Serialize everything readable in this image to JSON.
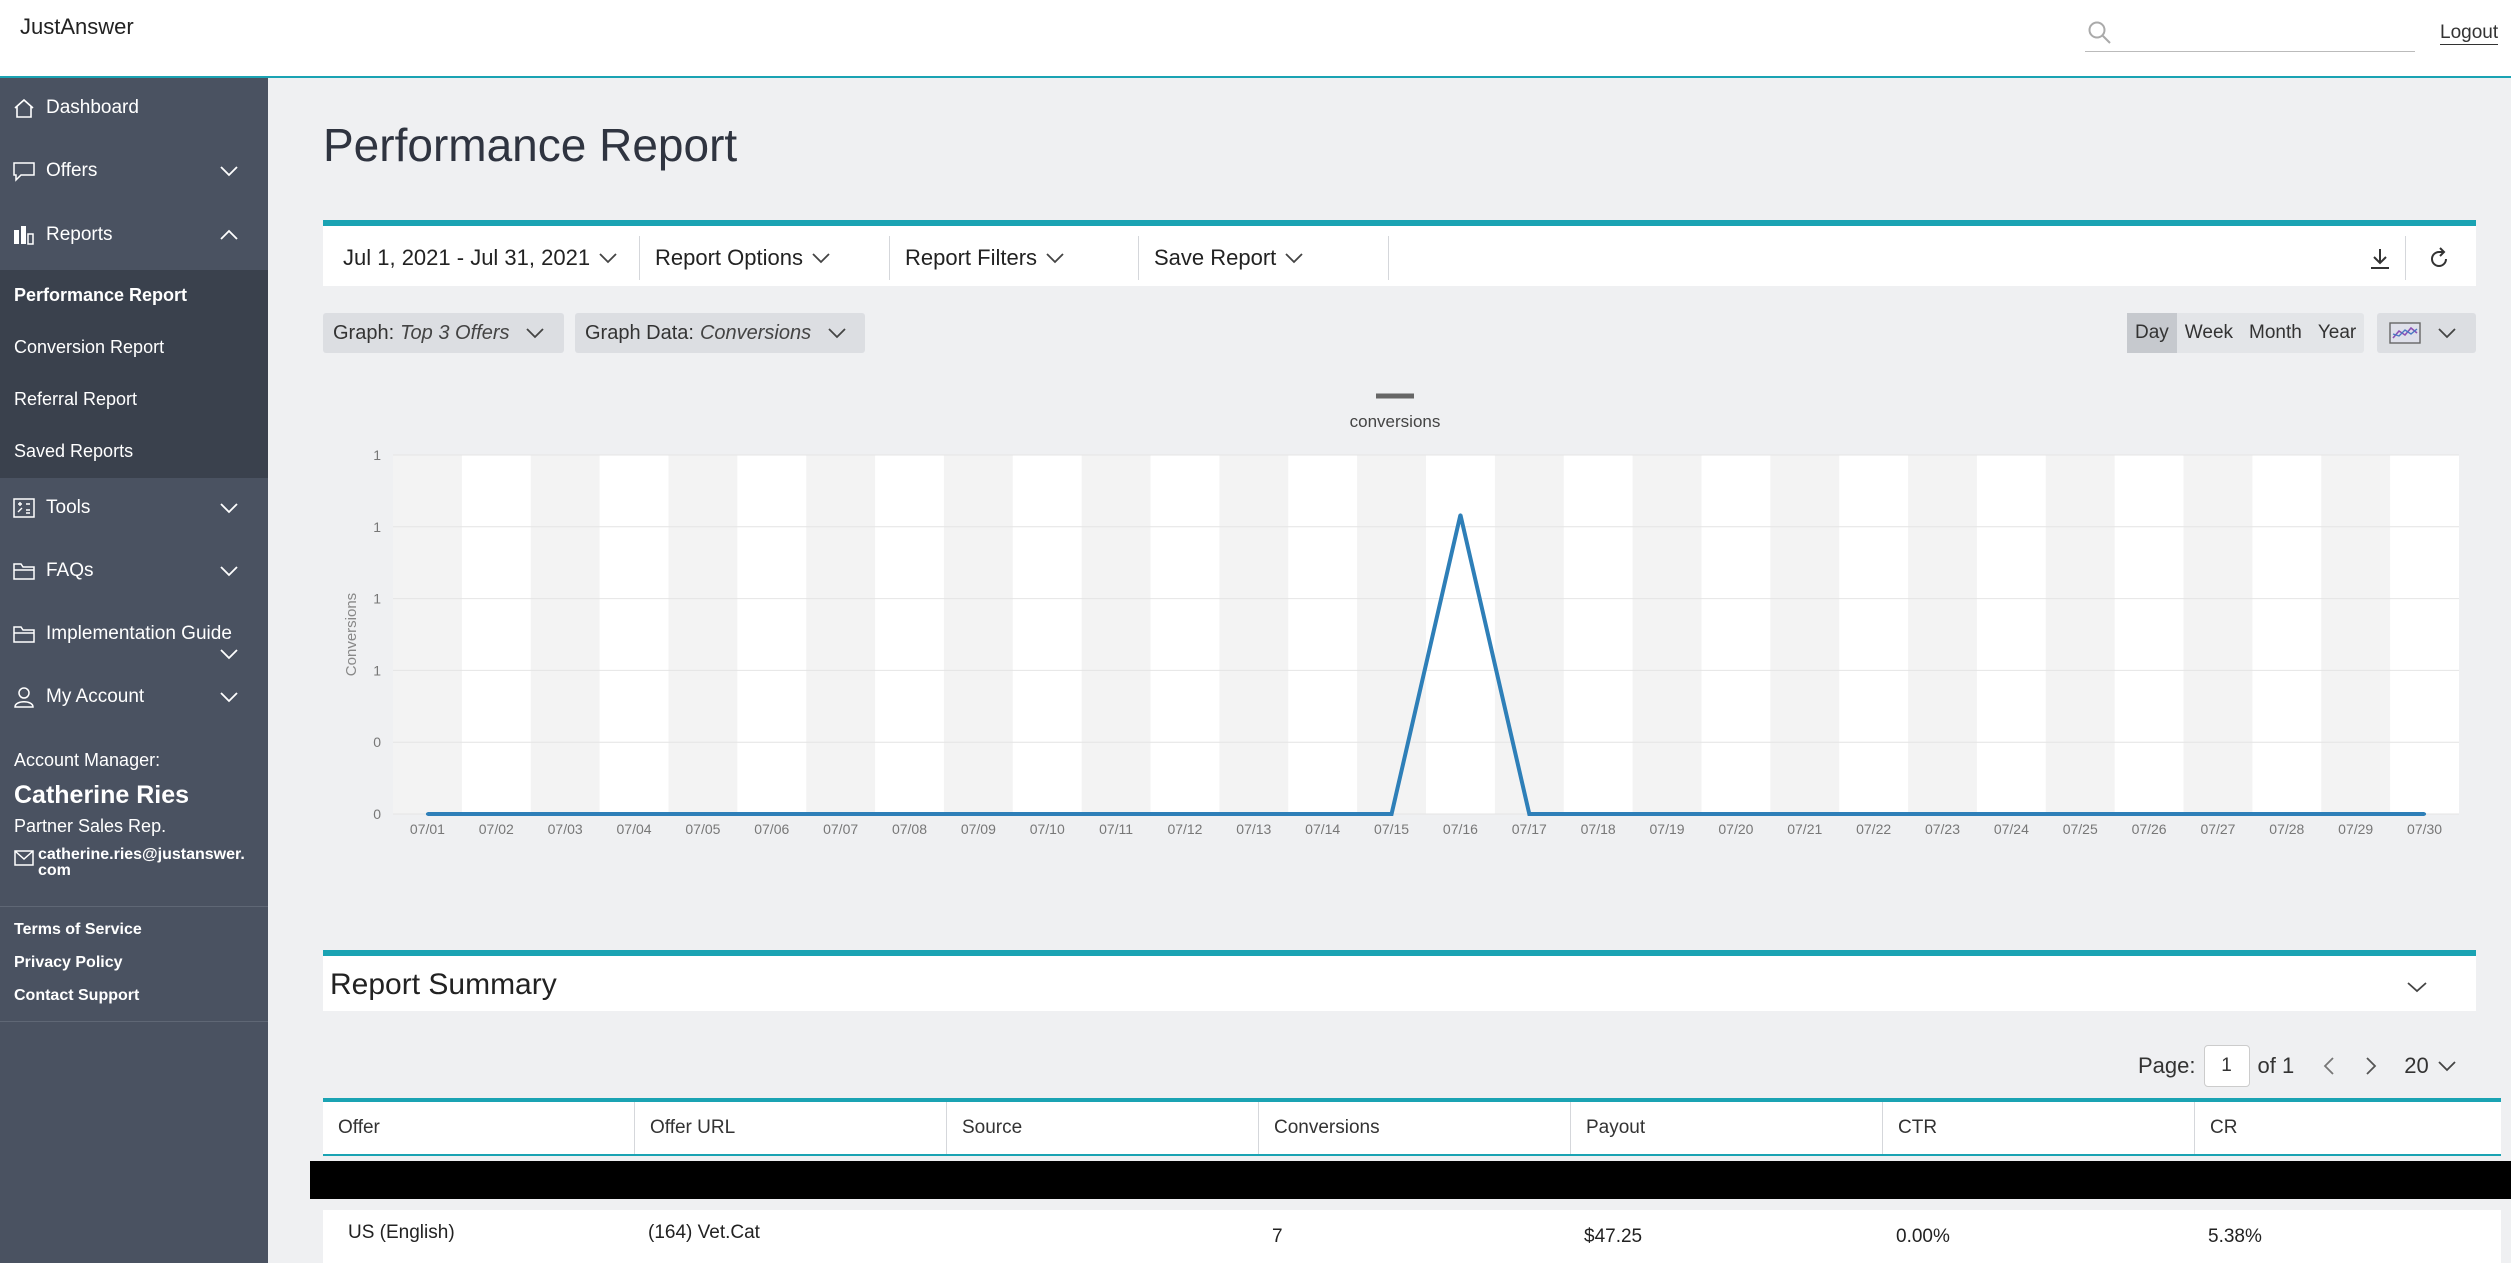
{
  "header": {
    "brand": "JustAnswer",
    "search_placeholder": "",
    "logout": "Logout"
  },
  "sidebar": {
    "items": [
      {
        "label": "Dashboard",
        "icon": "home-icon",
        "expandable": false
      },
      {
        "label": "Offers",
        "icon": "speech-bubble-icon",
        "expandable": true
      },
      {
        "label": "Reports",
        "icon": "bar-chart-icon",
        "expandable": true,
        "expanded": true
      },
      {
        "label": "Tools",
        "icon": "tools-icon",
        "expandable": true
      },
      {
        "label": "FAQs",
        "icon": "folder-icon",
        "expandable": true
      },
      {
        "label": "Implementation Guide",
        "icon": "folder-icon",
        "expandable": true
      },
      {
        "label": "My Account",
        "icon": "user-icon",
        "expandable": true
      }
    ],
    "reports_submenu": [
      "Performance Report",
      "Conversion Report",
      "Referral Report",
      "Saved Reports"
    ],
    "account": {
      "label": "Account Manager:",
      "name": "Catherine Ries",
      "role": "Partner Sales Rep.",
      "email_line1": "catherine.ries@justanswer.",
      "email_line2": "com"
    },
    "footer_links": [
      "Terms of Service",
      "Privacy Policy",
      "Contact Support"
    ]
  },
  "page": {
    "title": "Performance Report"
  },
  "toolbar": {
    "date_range": "Jul 1, 2021 - Jul 31, 2021",
    "report_options": "Report Options",
    "report_filters": "Report Filters",
    "save_report": "Save Report"
  },
  "graph_controls": {
    "graph_label": "Graph:",
    "graph_value": "Top 3 Offers",
    "data_label": "Graph Data:",
    "data_value": "Conversions",
    "periods": [
      "Day",
      "Week",
      "Month",
      "Year"
    ],
    "active_period": "Day"
  },
  "chart_data": {
    "type": "line",
    "title": "",
    "xlabel": "",
    "ylabel": "Conversions",
    "legend": [
      "conversions"
    ],
    "legend_position": "top-center",
    "x": [
      "07/01",
      "07/02",
      "07/03",
      "07/04",
      "07/05",
      "07/06",
      "07/07",
      "07/08",
      "07/09",
      "07/10",
      "07/11",
      "07/12",
      "07/13",
      "07/14",
      "07/15",
      "07/16",
      "07/17",
      "07/18",
      "07/19",
      "07/20",
      "07/21",
      "07/22",
      "07/23",
      "07/24",
      "07/25",
      "07/26",
      "07/27",
      "07/28",
      "07/29",
      "07/30"
    ],
    "series": [
      {
        "name": "conversions",
        "values": [
          0,
          0,
          0,
          0,
          0,
          0,
          0,
          0,
          0,
          0,
          0,
          0,
          0,
          0,
          0,
          1,
          0,
          0,
          0,
          0,
          0,
          0,
          0,
          0,
          0,
          0,
          0,
          0,
          0,
          0
        ]
      }
    ],
    "yticks": [
      "0",
      "0",
      "1",
      "1",
      "1",
      "1"
    ],
    "ylim": [
      0,
      1.2
    ],
    "grid": true,
    "colors": {
      "line": "#2e7fb8",
      "band": "#f3f3f3"
    }
  },
  "summary": {
    "title": "Report Summary"
  },
  "pager": {
    "label": "Page:",
    "current": "1",
    "of": "of 1",
    "page_size": "20"
  },
  "table": {
    "columns": [
      "Offer",
      "Offer URL",
      "Source",
      "Conversions",
      "Payout",
      "CTR",
      "CR"
    ],
    "rows": [
      [
        "US (English)",
        "(164) Vet.Cat",
        "",
        "7",
        "$47.25",
        "0.00%",
        "5.38%"
      ]
    ]
  }
}
